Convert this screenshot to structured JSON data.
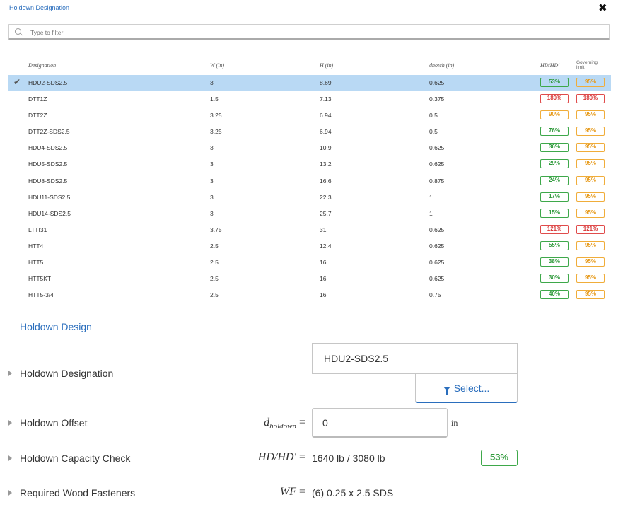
{
  "header": {
    "title": "Holdown Designation",
    "close": "✖"
  },
  "filter": {
    "placeholder": "Type to filter",
    "value": ""
  },
  "table": {
    "headers": {
      "designation": "Designation",
      "w": "W (in)",
      "h": "H (in)",
      "dnotch": "dnotch (in)",
      "ratio": "HD/HD'",
      "gov_line1": "Governing",
      "gov_line2": "limit"
    },
    "rows": [
      {
        "designation": "HDU2-SDS2.5",
        "w": "3",
        "h": "8.69",
        "d": "0.625",
        "ratio": "53%",
        "ratio_status": "green",
        "gov": "95%",
        "gov_status": "orange",
        "selected": true
      },
      {
        "designation": "DTT1Z",
        "w": "1.5",
        "h": "7.13",
        "d": "0.375",
        "ratio": "180%",
        "ratio_status": "red",
        "gov": "180%",
        "gov_status": "red"
      },
      {
        "designation": "DTT2Z",
        "w": "3.25",
        "h": "6.94",
        "d": "0.5",
        "ratio": "90%",
        "ratio_status": "orange",
        "gov": "95%",
        "gov_status": "orange"
      },
      {
        "designation": "DTT2Z-SDS2.5",
        "w": "3.25",
        "h": "6.94",
        "d": "0.5",
        "ratio": "76%",
        "ratio_status": "green",
        "gov": "95%",
        "gov_status": "orange"
      },
      {
        "designation": "HDU4-SDS2.5",
        "w": "3",
        "h": "10.9",
        "d": "0.625",
        "ratio": "36%",
        "ratio_status": "green",
        "gov": "95%",
        "gov_status": "orange"
      },
      {
        "designation": "HDU5-SDS2.5",
        "w": "3",
        "h": "13.2",
        "d": "0.625",
        "ratio": "29%",
        "ratio_status": "green",
        "gov": "95%",
        "gov_status": "orange"
      },
      {
        "designation": "HDU8-SDS2.5",
        "w": "3",
        "h": "16.6",
        "d": "0.875",
        "ratio": "24%",
        "ratio_status": "green",
        "gov": "95%",
        "gov_status": "orange"
      },
      {
        "designation": "HDU11-SDS2.5",
        "w": "3",
        "h": "22.3",
        "d": "1",
        "ratio": "17%",
        "ratio_status": "green",
        "gov": "95%",
        "gov_status": "orange"
      },
      {
        "designation": "HDU14-SDS2.5",
        "w": "3",
        "h": "25.7",
        "d": "1",
        "ratio": "15%",
        "ratio_status": "green",
        "gov": "95%",
        "gov_status": "orange"
      },
      {
        "designation": "LTTI31",
        "w": "3.75",
        "h": "31",
        "d": "0.625",
        "ratio": "121%",
        "ratio_status": "red",
        "gov": "121%",
        "gov_status": "red"
      },
      {
        "designation": "HTT4",
        "w": "2.5",
        "h": "12.4",
        "d": "0.625",
        "ratio": "55%",
        "ratio_status": "green",
        "gov": "95%",
        "gov_status": "orange"
      },
      {
        "designation": "HTT5",
        "w": "2.5",
        "h": "16",
        "d": "0.625",
        "ratio": "38%",
        "ratio_status": "green",
        "gov": "95%",
        "gov_status": "orange"
      },
      {
        "designation": "HTT5KT",
        "w": "2.5",
        "h": "16",
        "d": "0.625",
        "ratio": "30%",
        "ratio_status": "green",
        "gov": "95%",
        "gov_status": "orange"
      },
      {
        "designation": "HTT5-3/4",
        "w": "2.5",
        "h": "16",
        "d": "0.75",
        "ratio": "40%",
        "ratio_status": "green",
        "gov": "95%",
        "gov_status": "orange"
      }
    ]
  },
  "design": {
    "section_title": "Holdown Design",
    "designation": {
      "label": "Holdown Designation",
      "value": "HDU2-SDS2.5",
      "select_label": "Select..."
    },
    "offset": {
      "label": "Holdown Offset",
      "symbol": "d",
      "symbol_sub": "holdown",
      "equals": "=",
      "value": "0",
      "unit": "in"
    },
    "capacity": {
      "label": "Holdown Capacity Check",
      "symbol": "HD/HD′",
      "equals": "=",
      "value": "1640 lb / 3080 lb",
      "badge": "53%"
    },
    "fasteners": {
      "label": "Required Wood Fasteners",
      "symbol": "WF",
      "equals": "=",
      "value": "(6) 0.25 x 2.5 SDS"
    }
  },
  "colors": {
    "accent": "#2a6ebd",
    "selected_row": "#b9d9f4",
    "green": "#3ea84a",
    "red": "#e04b4b",
    "orange": "#f0ad3a"
  }
}
